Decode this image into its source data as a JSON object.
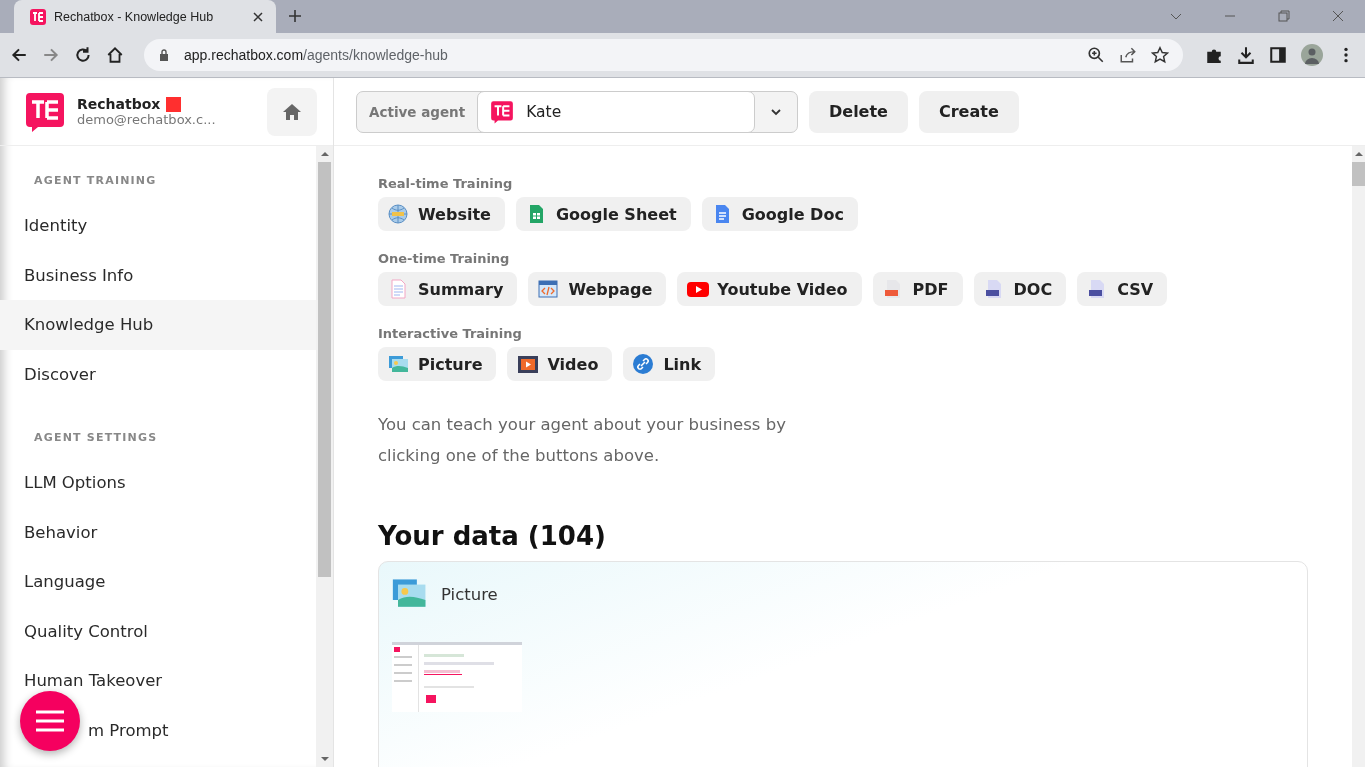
{
  "browser": {
    "tab_title": "Rechatbox - Knowledge Hub",
    "url_host": "app.rechatbox.com",
    "url_path": "/agents/knowledge-hub"
  },
  "account": {
    "name": "Rechatbox",
    "email": "demo@rechatbox.c..."
  },
  "agent_bar": {
    "label": "Active agent",
    "agent": "Kate",
    "buttons": [
      "Delete",
      "Create"
    ]
  },
  "sidebar": {
    "sections": [
      {
        "title": "AGENT TRAINING",
        "items": [
          {
            "label": "Identity",
            "selected": false
          },
          {
            "label": "Business Info",
            "selected": false
          },
          {
            "label": "Knowledge Hub",
            "selected": true
          },
          {
            "label": "Discover",
            "selected": false
          }
        ]
      },
      {
        "title": "AGENT SETTINGS",
        "items": [
          {
            "label": "LLM Options",
            "selected": false
          },
          {
            "label": "Behavior",
            "selected": false
          },
          {
            "label": "Language",
            "selected": false
          },
          {
            "label": "Quality Control",
            "selected": false
          },
          {
            "label": "Human Takeover",
            "selected": false
          },
          {
            "label": "m Prompt",
            "selected": false,
            "partly_hidden": true
          }
        ]
      }
    ]
  },
  "training_groups": [
    {
      "title": "Real-time Training",
      "buttons": [
        {
          "label": "Website",
          "kind": "globe"
        },
        {
          "label": "Google Sheet",
          "kind": "sheet"
        },
        {
          "label": "Google Doc",
          "kind": "doc"
        }
      ]
    },
    {
      "title": "One-time Training",
      "buttons": [
        {
          "label": "Summary",
          "kind": "summary"
        },
        {
          "label": "Webpage",
          "kind": "code"
        },
        {
          "label": "Youtube Video",
          "kind": "youtube"
        },
        {
          "label": "PDF",
          "kind": "pdf"
        },
        {
          "label": "DOC",
          "kind": "docx"
        },
        {
          "label": "CSV",
          "kind": "csv"
        }
      ]
    },
    {
      "title": "Interactive Training",
      "buttons": [
        {
          "label": "Picture",
          "kind": "picture"
        },
        {
          "label": "Video",
          "kind": "film"
        },
        {
          "label": "Link",
          "kind": "link"
        }
      ]
    }
  ],
  "hint": "You can teach your agent about your business by clicking one of the buttons above.",
  "data": {
    "title": "Your data (104)",
    "items": [
      {
        "type": "Picture",
        "kind": "picture"
      }
    ]
  }
}
